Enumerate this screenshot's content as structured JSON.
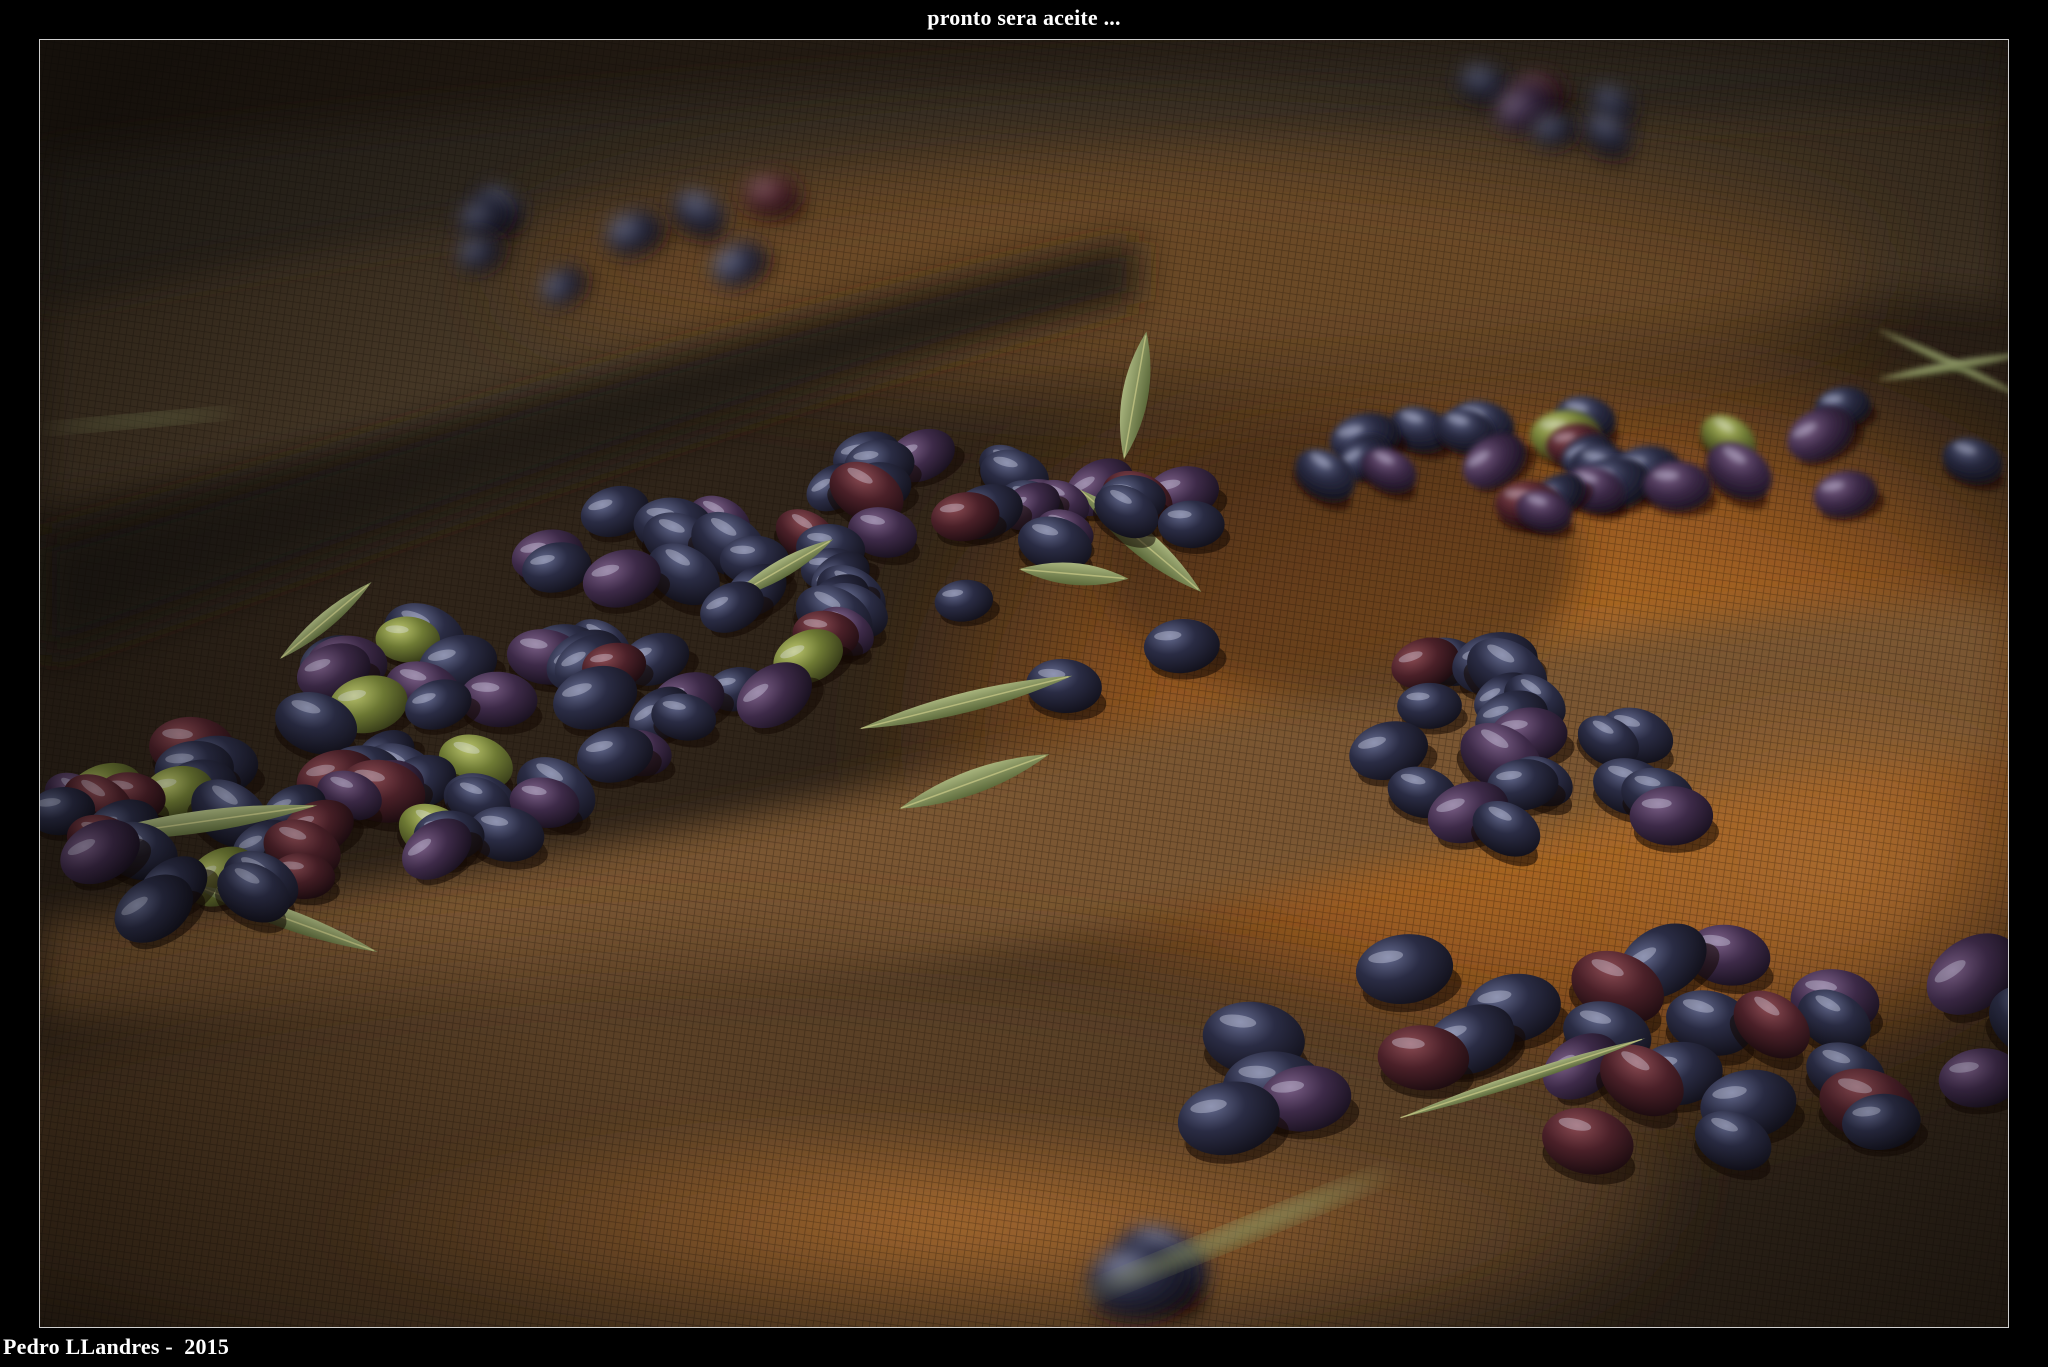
{
  "title": "pronto sera aceite ...",
  "credit": "Pedro LLandres -  2015",
  "colors": {
    "frame": "#000000",
    "text": "#ffffff",
    "net": "#9a5a20",
    "olive": "#2a2c44",
    "leaf": "#7d8c56"
  }
}
